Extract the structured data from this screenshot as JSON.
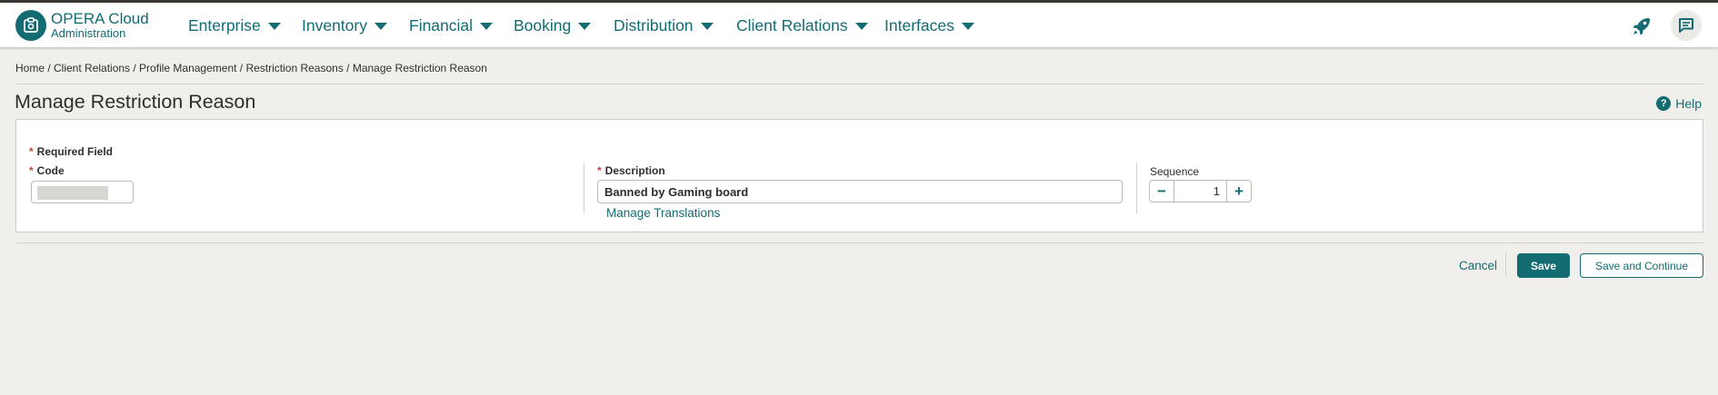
{
  "app": {
    "brand_title": "OPERA Cloud",
    "brand_subtitle": "Administration",
    "accent_color": "#136c72"
  },
  "nav": {
    "items": [
      {
        "label": "Enterprise"
      },
      {
        "label": "Inventory"
      },
      {
        "label": "Financial"
      },
      {
        "label": "Booking"
      },
      {
        "label": "Distribution"
      },
      {
        "label": "Client Relations"
      },
      {
        "label": "Interfaces"
      }
    ],
    "icons": [
      "rocket-icon",
      "messages-icon"
    ]
  },
  "breadcrumb": "Home / Client Relations / Profile Management / Restriction Reasons / Manage Restriction Reason",
  "page": {
    "title": "Manage Restriction Reason",
    "help_label": "Help"
  },
  "form": {
    "required_label": "Required Field",
    "code": {
      "label": "Code",
      "value": ""
    },
    "description": {
      "label": "Description",
      "value": "Banned by Gaming board"
    },
    "manage_translations": "Manage Translations",
    "sequence": {
      "label": "Sequence",
      "value": "1"
    }
  },
  "actions": {
    "cancel": "Cancel",
    "save": "Save",
    "save_continue": "Save and Continue"
  }
}
